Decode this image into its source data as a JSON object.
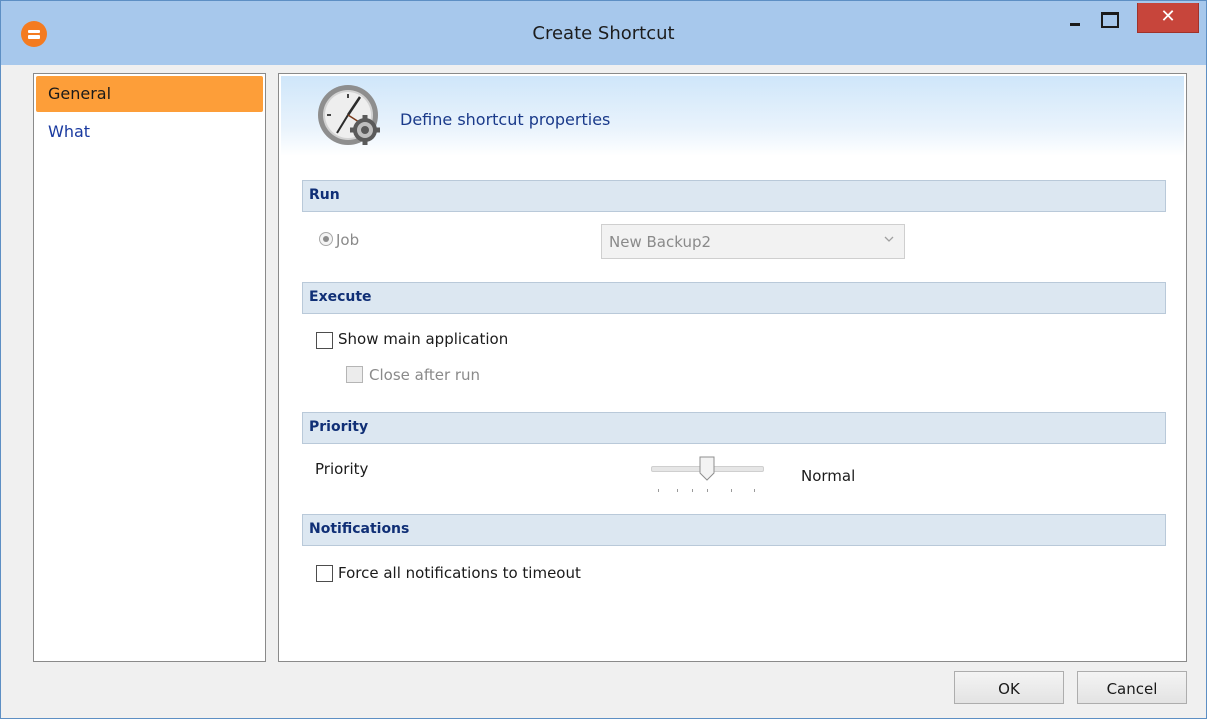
{
  "window": {
    "title": "Create Shortcut",
    "close_glyph": "✕"
  },
  "nav": {
    "items": [
      {
        "label": "General",
        "active": true
      },
      {
        "label": "What",
        "active": false
      }
    ]
  },
  "header": {
    "text": "Define shortcut properties",
    "icon": "clock-gear-icon"
  },
  "sections": {
    "run": {
      "title": "Run",
      "job_label": "Job",
      "job_selected": true,
      "job_value": "New Backup2"
    },
    "execute": {
      "title": "Execute",
      "show_main_label": "Show main application",
      "show_main_checked": false,
      "close_after_label": "Close after run",
      "close_after_checked": false
    },
    "priority": {
      "title": "Priority",
      "label": "Priority",
      "value_text": "Normal",
      "slider_level": 0.5
    },
    "notifications": {
      "title": "Notifications",
      "force_timeout_label": "Force all notifications to timeout",
      "force_timeout_checked": false
    }
  },
  "buttons": {
    "ok": "OK",
    "cancel": "Cancel"
  },
  "colors": {
    "titlebar": "#a7c8ec",
    "active_nav": "#fd9e39",
    "section_bg": "#dce7f1",
    "section_text": "#102f76",
    "close_button": "#c7453b"
  }
}
